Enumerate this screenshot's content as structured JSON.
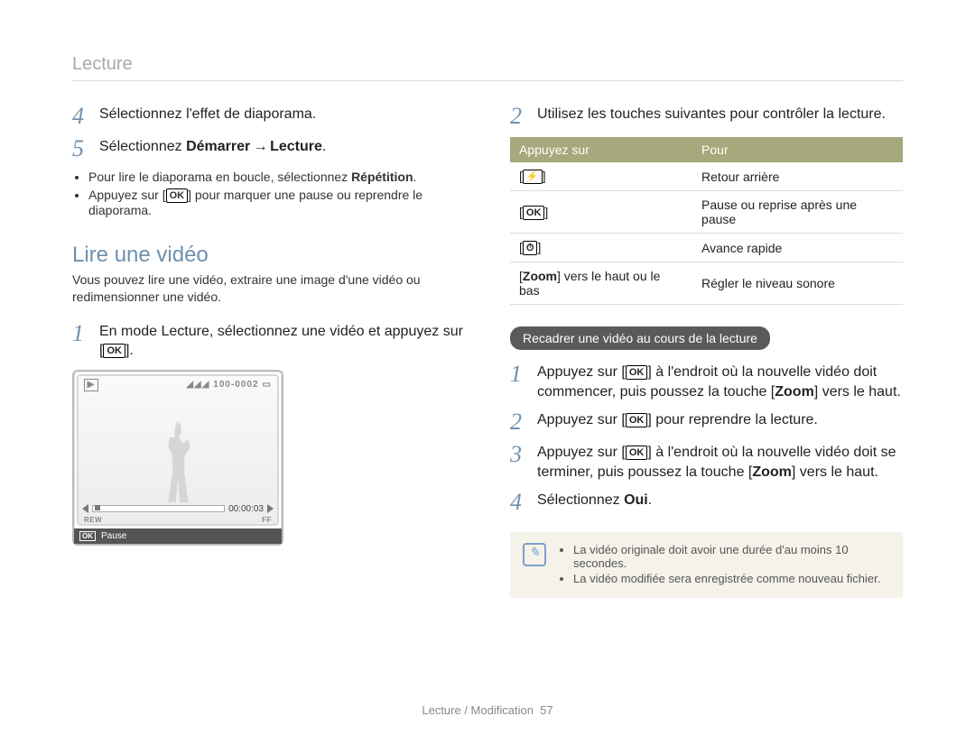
{
  "header": {
    "section": "Lecture"
  },
  "left": {
    "step4": "Sélectionnez l'effet de diaporama.",
    "step5_pre": "Sélectionnez ",
    "step5_bold": "Démarrer",
    "step5_arrow": " → ",
    "step5_bold2": "Lecture",
    "step5_post": ".",
    "sub1_pre": "Pour lire le diaporama en boucle, sélectionnez ",
    "sub1_bold": "Répétition",
    "sub1_post": ".",
    "sub2_pre": "Appuyez sur [",
    "sub2_ok": "OK",
    "sub2_post": "] pour marquer une pause ou reprendre le diaporama.",
    "heading": "Lire une vidéo",
    "desc": "Vous pouvez lire une vidéo, extraire une image d'une vidéo ou redimensionner une vidéo.",
    "v_step1_pre": "En mode Lecture, sélectionnez une vidéo et appuyez sur [",
    "v_step1_ok": "OK",
    "v_step1_post": "].",
    "screen": {
      "counter": "100-0002",
      "time": "00:00:03",
      "rew": "REW",
      "ff": "FF",
      "ok": "OK",
      "pause": "Pause"
    }
  },
  "right": {
    "step2": "Utilisez les touches suivantes pour contrôler la lecture.",
    "table": {
      "h1": "Appuyez sur",
      "h2": "Pour",
      "rows": [
        {
          "key_icon": "⚡",
          "key_text": "",
          "val": "Retour arrière"
        },
        {
          "key_icon": "",
          "key_text": "OK",
          "val": "Pause ou reprise après une pause"
        },
        {
          "key_icon": "⏱",
          "key_text": "",
          "val": "Avance rapide"
        },
        {
          "key_icon": "",
          "key_text": "",
          "key_plain_pre": "[",
          "key_plain_bold": "Zoom",
          "key_plain_post": "] vers le haut ou le bas",
          "val": "Régler le niveau sonore"
        }
      ]
    },
    "pill": "Recadrer une vidéo au cours de la lecture",
    "trim": {
      "s1_pre": "Appuyez sur [",
      "ok": "OK",
      "s1_mid": "] à l'endroit où la nouvelle vidéo doit commencer, puis poussez la touche [",
      "zoom": "Zoom",
      "s1_post": "] vers le haut.",
      "s2_pre": "Appuyez sur [",
      "s2_post": "] pour reprendre la lecture.",
      "s3_pre": "Appuyez sur [",
      "s3_mid": "] à l'endroit où la nouvelle vidéo doit se terminer, puis poussez la touche [",
      "s3_post": "] vers le haut.",
      "s4_pre": "Sélectionnez ",
      "s4_bold": "Oui",
      "s4_post": "."
    },
    "notes": {
      "n1": "La vidéo originale doit avoir une durée d'au moins 10 secondes.",
      "n2": "La vidéo modifiée sera enregistrée comme nouveau fichier."
    }
  },
  "footer": {
    "text": "Lecture / Modification",
    "page": "57"
  }
}
